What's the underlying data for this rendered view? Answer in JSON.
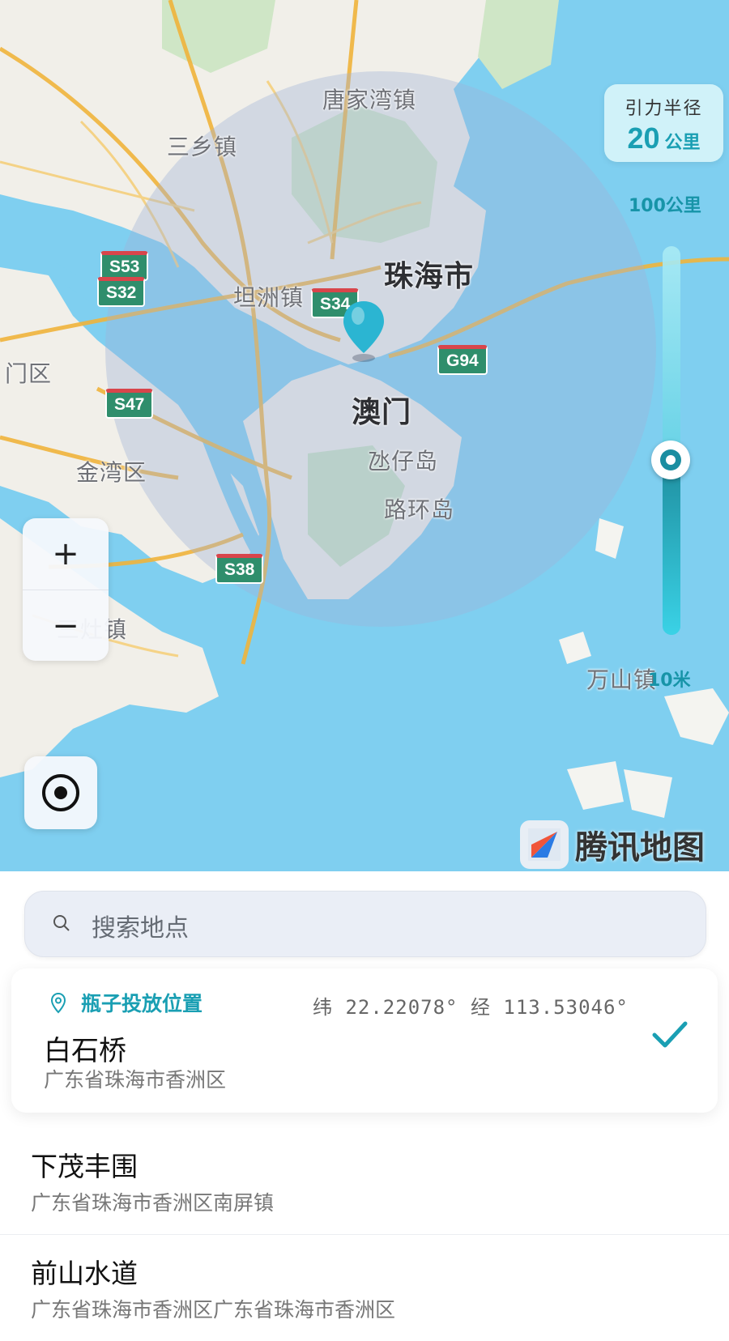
{
  "map": {
    "labels": {
      "tangjiawan": "唐家湾镇",
      "sanxiang": "三乡镇",
      "zhuhai": "珠海市",
      "tanzhou": "坦洲镇",
      "menqu": "门区",
      "macau": "澳门",
      "taipa": "氹仔岛",
      "coloane": "路环岛",
      "jinwan": "金湾区",
      "sanzao": "三灶镇",
      "wanshan": "万山镇"
    },
    "shields": {
      "s53": "S53",
      "s32": "S32",
      "s34": "S34",
      "g94": "G94",
      "s47": "S47",
      "s38": "S38"
    },
    "radius": {
      "title": "引力半径",
      "value": "20",
      "unit": "公里"
    },
    "slider": {
      "max_label": "100公里",
      "min_label": "10米",
      "fraction": 0.45
    },
    "zoom": {
      "in": "+",
      "out": "−"
    },
    "logo_text": "腾讯地图"
  },
  "search": {
    "placeholder": "搜索地点",
    "icon": "search-icon"
  },
  "selected": {
    "tag": "瓶子投放位置",
    "coords": "纬 22.22078° 经 113.53046°",
    "title": "白石桥",
    "address": "广东省珠海市香洲区"
  },
  "results": [
    {
      "title": "下茂丰围",
      "address": "广东省珠海市香洲区南屏镇"
    },
    {
      "title": "前山水道",
      "address": "广东省珠海市香洲区广东省珠海市香洲区"
    }
  ],
  "colors": {
    "accent": "#1a9fb3",
    "water": "#7fcff0",
    "land": "#f1efe9",
    "road": "#f0b43c"
  }
}
